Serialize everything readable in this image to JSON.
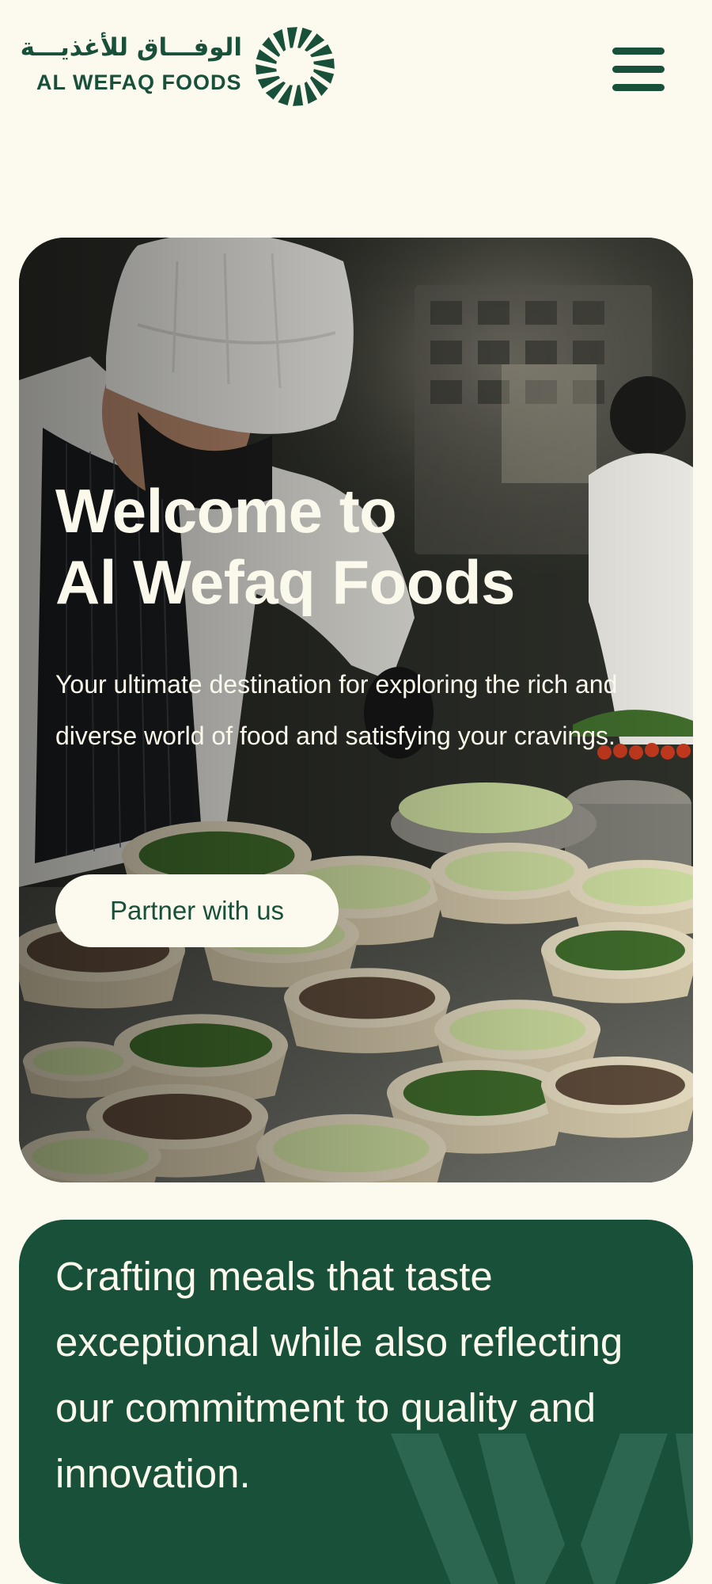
{
  "brand": {
    "name_arabic": "الوفـــاق للأغذيـــة",
    "name_english": "AL WEFAQ FOODS",
    "logo_icon": "starburst-logo-mark",
    "primary_color": "#18503a",
    "background_color": "#fcf9ee"
  },
  "header": {
    "menu_icon": "hamburger-menu-icon"
  },
  "hero": {
    "title_line1": "Welcome to",
    "title_line2": "Al Wefaq Foods",
    "description": "Your ultimate destination for exploring the rich and diverse world of food and satisfying your cravings.",
    "cta_label": "Partner with us",
    "image_subject": "chef garnishing rows of salad bowls in a kitchen"
  },
  "mission": {
    "text": "Crafting meals that taste exceptional while also reflecting our commitment to quality and innovation."
  }
}
